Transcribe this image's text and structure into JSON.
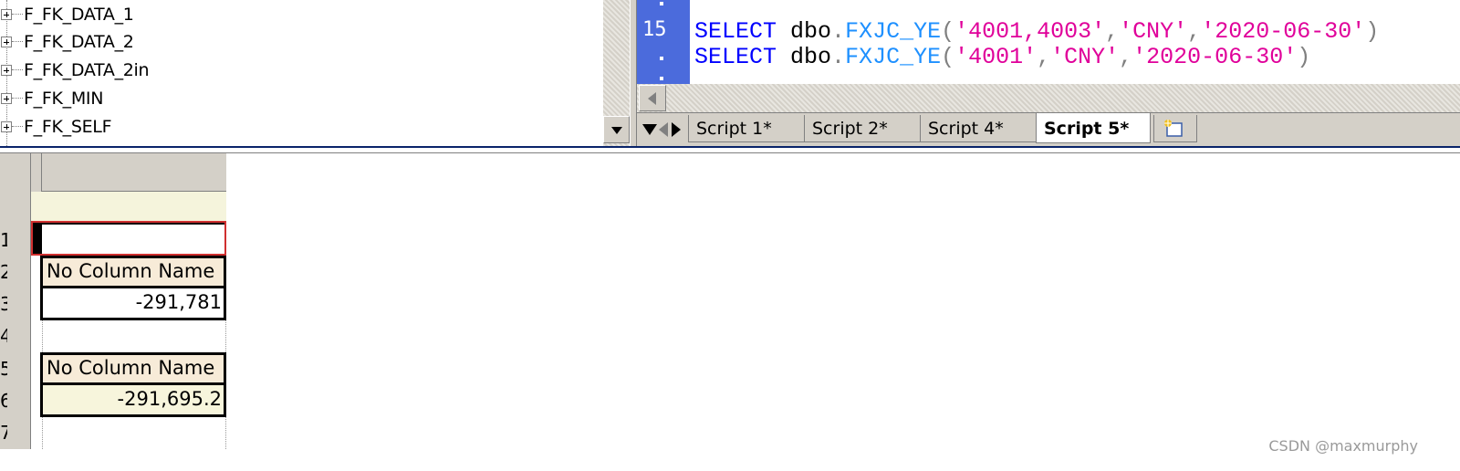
{
  "object_tree": {
    "items": [
      {
        "label": "F_FK_DATA_1"
      },
      {
        "label": "F_FK_DATA_2"
      },
      {
        "label": "F_FK_DATA_2in"
      },
      {
        "label": "F_FK_MIN"
      },
      {
        "label": "F_FK_SELF"
      }
    ]
  },
  "editor": {
    "line_number": "15",
    "lines": [
      {
        "kw": "SELECT",
        "obj": "dbo",
        "dot": ".",
        "fn": "FXJC_YE",
        "open": "(",
        "arg1": "'4001,4003'",
        "sep1": ",",
        "arg2": "'CNY'",
        "sep2": ",",
        "arg3": "'2020-06-30'",
        "close": ")"
      },
      {
        "kw": "SELECT",
        "obj": "dbo",
        "dot": ".",
        "fn": "FXJC_YE",
        "open": "(",
        "arg1": "'4001'",
        "sep1": ",",
        "arg2": "'CNY'",
        "sep2": ",",
        "arg3": "'2020-06-30'",
        "close": ")"
      }
    ]
  },
  "tabs": [
    {
      "label": "Script 1*",
      "active": false
    },
    {
      "label": "Script 2*",
      "active": false
    },
    {
      "label": "Script 4*",
      "active": false
    },
    {
      "label": "Script 5*",
      "active": true
    }
  ],
  "results": {
    "row_numbers": [
      "1",
      "2",
      "3",
      "4",
      "5",
      "6",
      "7"
    ],
    "result_sets": [
      {
        "header": "No Column Name",
        "value": "-291,781"
      },
      {
        "header": "No Column Name",
        "value": "-291,695.2"
      }
    ]
  },
  "watermark": "CSDN @maxmurphy",
  "colors": {
    "gutter": "#4b6bdc",
    "keyword": "#0000ff",
    "function": "#1e90ff",
    "string": "#e0009a",
    "header_cell": "#f7ebd8",
    "selection_border": "#d03030"
  }
}
